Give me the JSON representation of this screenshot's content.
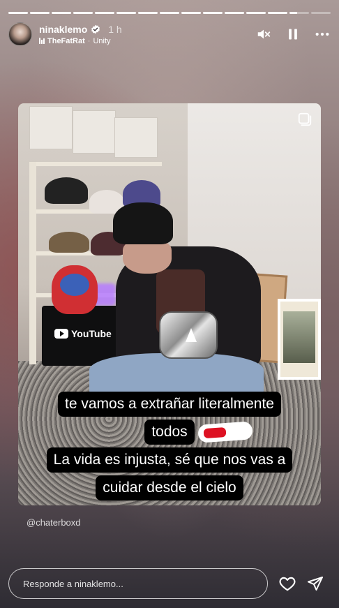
{
  "story": {
    "progress": [
      1,
      1,
      1,
      1,
      1,
      1,
      1,
      1,
      1,
      1,
      1,
      1,
      1,
      0.4,
      0
    ]
  },
  "header": {
    "username": "ninaklemo",
    "time": "1 h",
    "music": {
      "artist": "TheFatRat",
      "song": "Unity",
      "separator": "·"
    }
  },
  "icons": {
    "verified": "verified-badge-icon",
    "mute": "speaker-muted-icon",
    "pause": "pause-icon",
    "more": "more-options-icon",
    "like": "heart-icon",
    "share": "send-icon"
  },
  "photo": {
    "youtube_label": "YouTube"
  },
  "captions": {
    "line1": "te vamos a extrañar literalmente",
    "line2": "todos",
    "line3": "La vida es injusta, sé que nos vas a",
    "line4": "cuidar desde el cielo"
  },
  "mention": "@chaterboxd",
  "reply": {
    "placeholder": "Responde a ninaklemo..."
  },
  "colors": {
    "caption_bg": "#000000",
    "text": "#ffffff",
    "verified": "#ffffff"
  }
}
